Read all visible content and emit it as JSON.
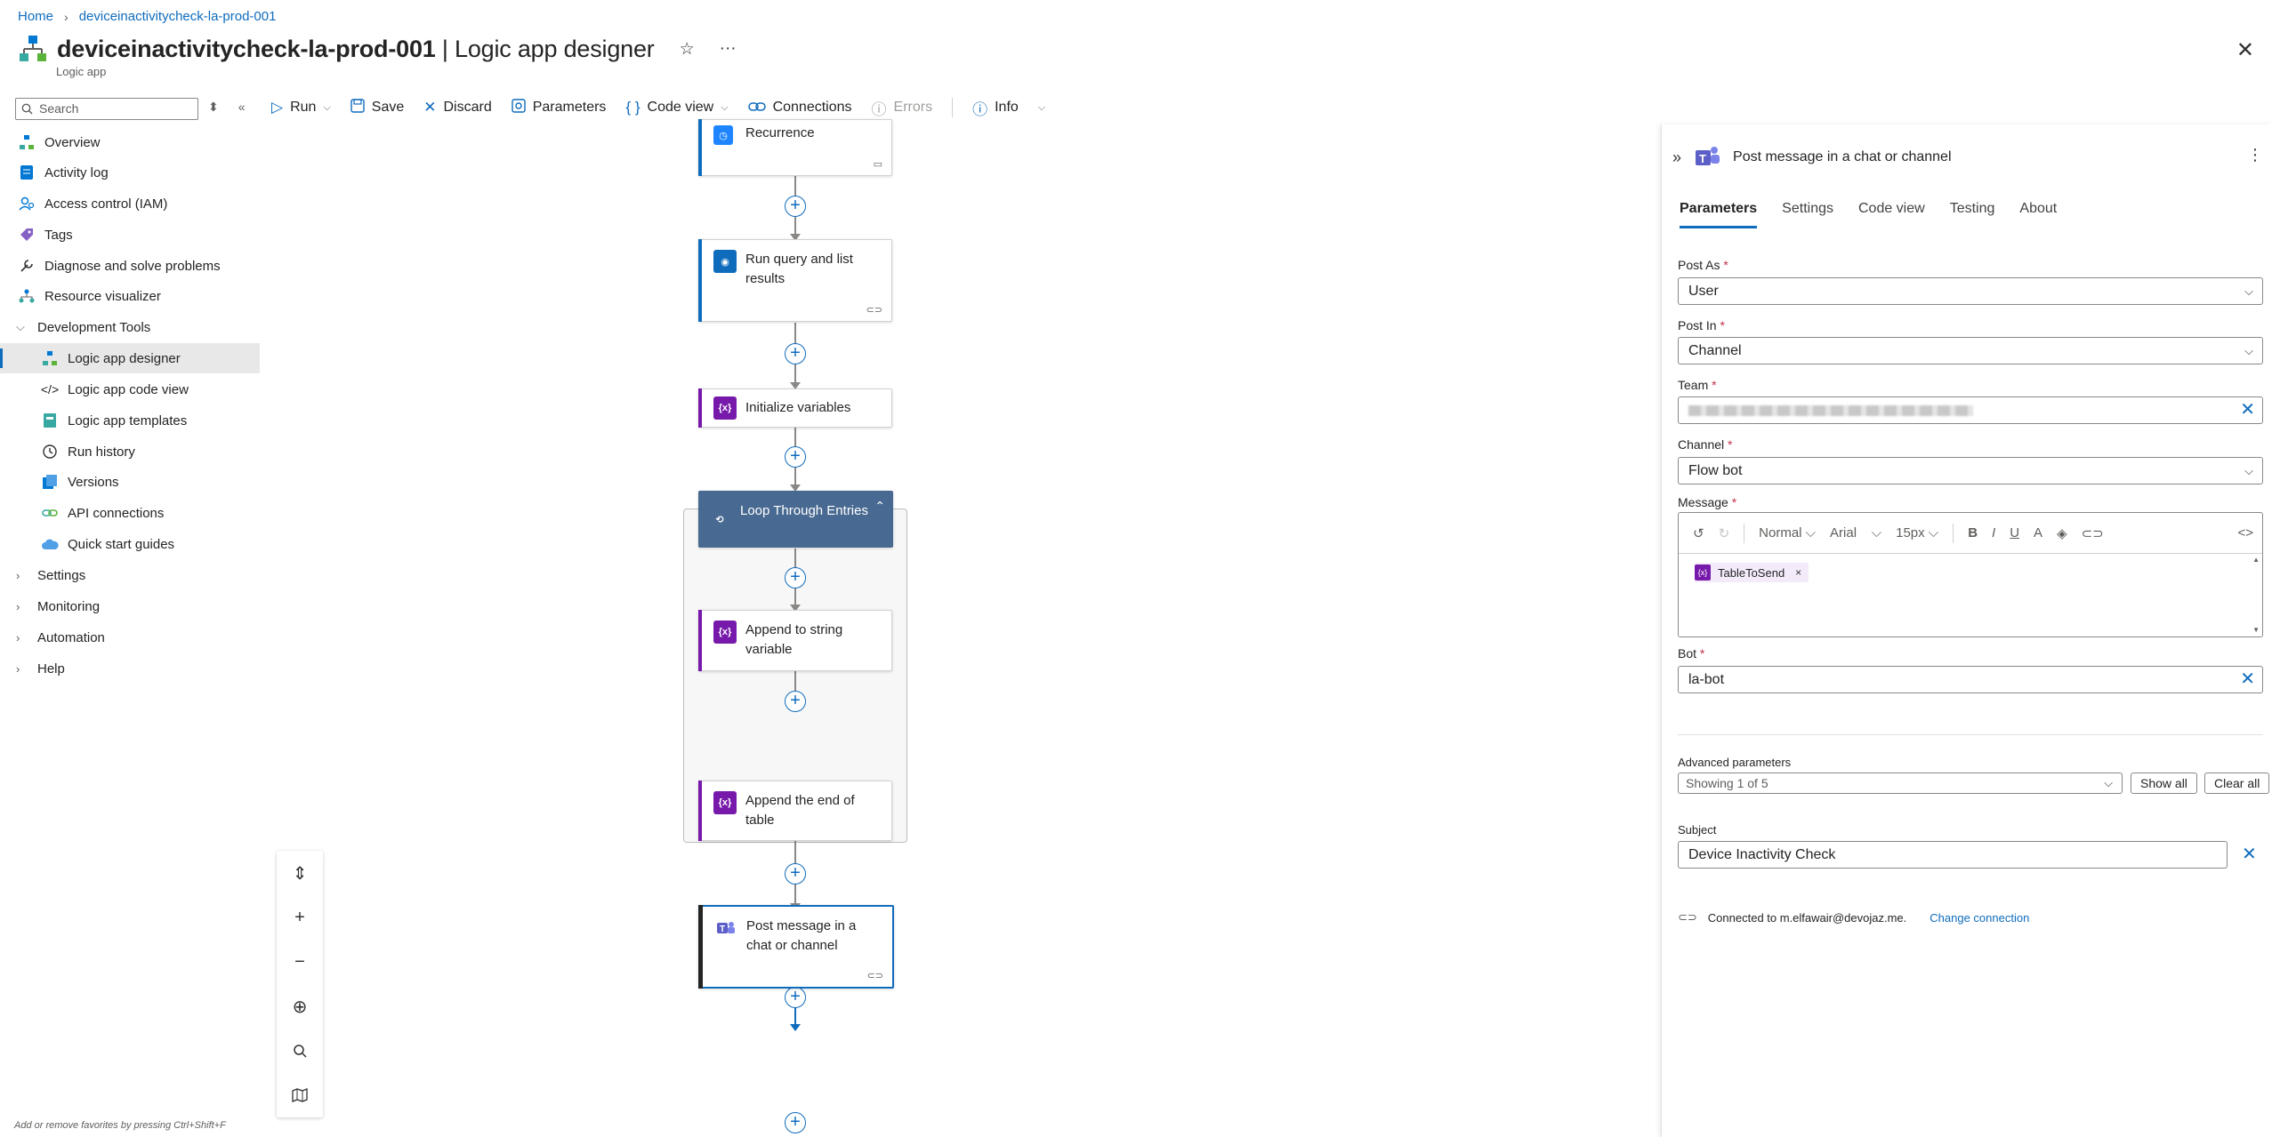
{
  "breadcrumb": {
    "home": "Home",
    "resource": "deviceinactivitycheck-la-prod-001"
  },
  "header": {
    "title_bold": "deviceinactivitycheck-la-prod-001",
    "title_light": "| Logic app designer",
    "subtitle": "Logic app"
  },
  "sidebar": {
    "search_placeholder": "Search",
    "items": [
      {
        "label": "Overview"
      },
      {
        "label": "Activity log"
      },
      {
        "label": "Access control (IAM)"
      },
      {
        "label": "Tags"
      },
      {
        "label": "Diagnose and solve problems"
      },
      {
        "label": "Resource visualizer"
      },
      {
        "label": "Development Tools"
      },
      {
        "label": "Logic app designer"
      },
      {
        "label": "Logic app code view"
      },
      {
        "label": "Logic app templates"
      },
      {
        "label": "Run history"
      },
      {
        "label": "Versions"
      },
      {
        "label": "API connections"
      },
      {
        "label": "Quick start guides"
      },
      {
        "label": "Settings"
      },
      {
        "label": "Monitoring"
      },
      {
        "label": "Automation"
      },
      {
        "label": "Help"
      }
    ]
  },
  "toolbar": {
    "run": "Run",
    "save": "Save",
    "discard": "Discard",
    "parameters": "Parameters",
    "code_view": "Code view",
    "connections": "Connections",
    "errors": "Errors",
    "info": "Info"
  },
  "workflow": {
    "recurrence": "Recurrence",
    "run_query": "Run query and list results",
    "init_vars": "Initialize variables",
    "loop": "Loop Through Entries",
    "append_string": "Append to string variable",
    "append_end": "Append the end of table",
    "post_message": "Post message in a chat or channel"
  },
  "fav_hint": "Add or remove favorites by pressing Ctrl+Shift+F",
  "panel": {
    "title": "Post message in a chat or channel",
    "tabs": [
      "Parameters",
      "Settings",
      "Code view",
      "Testing",
      "About"
    ],
    "post_as_label": "Post As",
    "post_as_value": "User",
    "post_in_label": "Post In",
    "post_in_value": "Channel",
    "team_label": "Team",
    "channel_label": "Channel",
    "channel_value": "Flow bot",
    "message_label": "Message",
    "editor": {
      "style": "Normal",
      "font": "Arial",
      "size": "15px"
    },
    "token": "TableToSend",
    "bot_label": "Bot",
    "bot_value": "la-bot",
    "advanced_label": "Advanced parameters",
    "advanced_value": "Showing 1 of 5",
    "show_all": "Show all",
    "clear_all": "Clear all",
    "subject_label": "Subject",
    "subject_value": "Device Inactivity Check",
    "connected_text": "Connected to m.elfawair@devojaz.me.",
    "change_connection": "Change connection"
  },
  "colors": {
    "accent": "#0f6cbd",
    "variable": "#7719aa",
    "loop": "#486991",
    "teams": "#5b5fc7"
  }
}
